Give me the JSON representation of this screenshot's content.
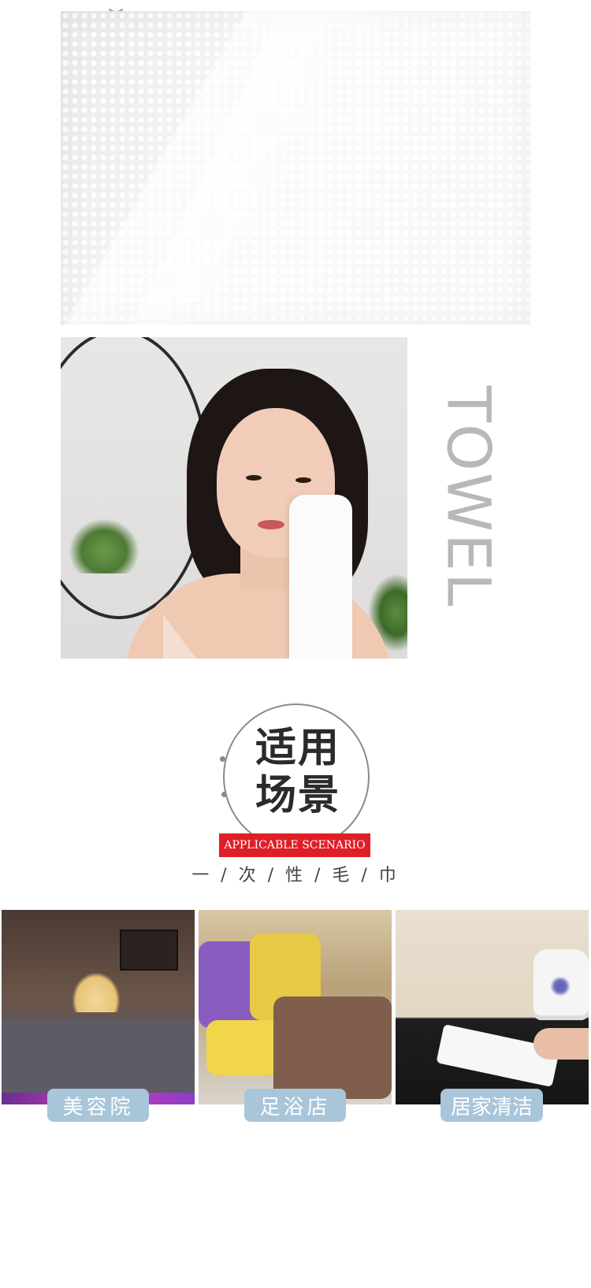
{
  "towel_label": "TOWEL",
  "section": {
    "title_line1": "适用",
    "title_line2": "场景",
    "english_label": "APPLICABLE SCENARIO",
    "subtitle": "一 / 次 / 性 / 毛 / 巾"
  },
  "scenarios": [
    {
      "label": "美容院"
    },
    {
      "label": "足浴店"
    },
    {
      "label": "居家清洁"
    }
  ],
  "colors": {
    "accent_red": "#e01e26",
    "pill_blue": "#a9c5d9",
    "towel_text_gray": "#b8b8b8"
  }
}
